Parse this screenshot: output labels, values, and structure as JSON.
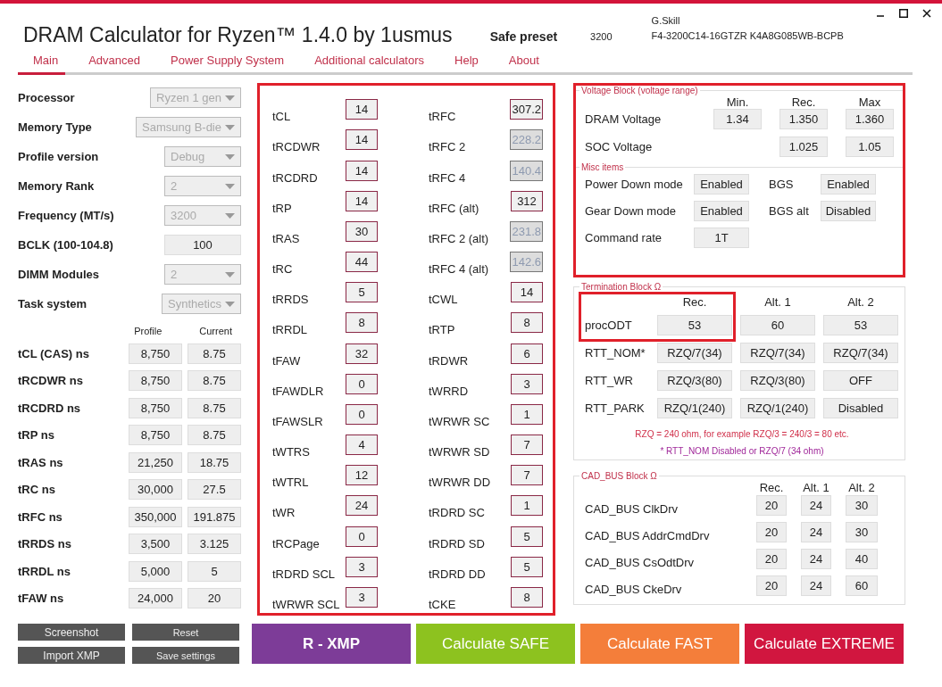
{
  "window": {
    "title": "DRAM Calculator for Ryzen™ 1.4.0 by 1usmus"
  },
  "preset": {
    "label": "Safe preset",
    "frequency": "3200"
  },
  "memory": {
    "vendor": "G.Skill",
    "part_number": "F4-3200C14-16GTZR K4A8G085WB-BCPB"
  },
  "tabs": [
    {
      "label": "Main",
      "selected": true
    },
    {
      "label": "Advanced",
      "selected": false
    },
    {
      "label": "Power Supply System",
      "selected": false
    },
    {
      "label": "Additional calculators",
      "selected": false
    },
    {
      "label": "Help",
      "selected": false
    },
    {
      "label": "About",
      "selected": false
    }
  ],
  "settings": [
    {
      "label": "Processor",
      "kind": "dropdown",
      "value": "Ryzen 1 gen",
      "disabled": true
    },
    {
      "label": "Memory Type",
      "kind": "dropdown",
      "value": "Samsung B-die",
      "disabled": true
    },
    {
      "label": "Profile version",
      "kind": "dropdown",
      "value": "Debug",
      "disabled": true
    },
    {
      "label": "Memory Rank",
      "kind": "dropdown",
      "value": "2",
      "disabled": true
    },
    {
      "label": "Frequency (MT/s)",
      "kind": "dropdown",
      "value": "3200",
      "disabled": true
    },
    {
      "label": "BCLK (100-104.8)",
      "kind": "field",
      "value": "100",
      "disabled": false
    },
    {
      "label": "DIMM Modules",
      "kind": "dropdown",
      "value": "2",
      "disabled": true
    },
    {
      "label": "Task system",
      "kind": "dropdown",
      "value": "Synthetics",
      "disabled": true
    }
  ],
  "ns_table": {
    "columns": [
      "Profile",
      "Current"
    ],
    "rows": [
      {
        "label": "tCL (CAS) ns",
        "profile": "8,750",
        "current": "8.75"
      },
      {
        "label": "tRCDWR ns",
        "profile": "8,750",
        "current": "8.75"
      },
      {
        "label": "tRCDRD ns",
        "profile": "8,750",
        "current": "8.75"
      },
      {
        "label": "tRP ns",
        "profile": "8,750",
        "current": "8.75"
      },
      {
        "label": "tRAS ns",
        "profile": "21,250",
        "current": "18.75"
      },
      {
        "label": "tRC ns",
        "profile": "30,000",
        "current": "27.5"
      },
      {
        "label": "tRFC ns",
        "profile": "350,000",
        "current": "191.875"
      },
      {
        "label": "tRRDS ns",
        "profile": "3,500",
        "current": "3.125"
      },
      {
        "label": "tRRDL ns",
        "profile": "5,000",
        "current": "5"
      },
      {
        "label": "tFAW ns",
        "profile": "24,000",
        "current": "20"
      }
    ]
  },
  "timings": {
    "highlighted": true,
    "left": [
      {
        "label": "tCL",
        "value": "14",
        "disabled": false
      },
      {
        "label": "tRCDWR",
        "value": "14",
        "disabled": false
      },
      {
        "label": "tRCDRD",
        "value": "14",
        "disabled": false
      },
      {
        "label": "tRP",
        "value": "14",
        "disabled": false
      },
      {
        "label": "tRAS",
        "value": "30",
        "disabled": false
      },
      {
        "label": "tRC",
        "value": "44",
        "disabled": false
      },
      {
        "label": "tRRDS",
        "value": "5",
        "disabled": false
      },
      {
        "label": "tRRDL",
        "value": "8",
        "disabled": false
      },
      {
        "label": "tFAW",
        "value": "32",
        "disabled": false
      },
      {
        "label": "tFAWDLR",
        "value": "0",
        "disabled": false
      },
      {
        "label": "tFAWSLR",
        "value": "0",
        "disabled": false
      },
      {
        "label": "tWTRS",
        "value": "4",
        "disabled": false
      },
      {
        "label": "tWTRL",
        "value": "12",
        "disabled": false
      },
      {
        "label": "tWR",
        "value": "24",
        "disabled": false
      },
      {
        "label": "tRCPage",
        "value": "0",
        "disabled": false
      },
      {
        "label": "tRDRD SCL",
        "value": "3",
        "disabled": false
      },
      {
        "label": "tWRWR SCL",
        "value": "3",
        "disabled": false
      }
    ],
    "right": [
      {
        "label": "tRFC",
        "value": "307.2",
        "disabled": false
      },
      {
        "label": "tRFC 2",
        "value": "228.2",
        "disabled": true
      },
      {
        "label": "tRFC 4",
        "value": "140.4",
        "disabled": true
      },
      {
        "label": "tRFC (alt)",
        "value": "312",
        "disabled": false
      },
      {
        "label": "tRFC 2 (alt)",
        "value": "231.8",
        "disabled": true
      },
      {
        "label": "tRFC 4 (alt)",
        "value": "142.6",
        "disabled": true
      },
      {
        "label": "tCWL",
        "value": "14",
        "disabled": false
      },
      {
        "label": "tRTP",
        "value": "8",
        "disabled": false
      },
      {
        "label": "tRDWR",
        "value": "6",
        "disabled": false
      },
      {
        "label": "tWRRD",
        "value": "3",
        "disabled": false
      },
      {
        "label": "tWRWR SC",
        "value": "1",
        "disabled": false
      },
      {
        "label": "tWRWR SD",
        "value": "7",
        "disabled": false
      },
      {
        "label": "tWRWR DD",
        "value": "7",
        "disabled": false
      },
      {
        "label": "tRDRD SC",
        "value": "1",
        "disabled": false
      },
      {
        "label": "tRDRD SD",
        "value": "5",
        "disabled": false
      },
      {
        "label": "tRDRD DD",
        "value": "5",
        "disabled": false
      },
      {
        "label": "tCKE",
        "value": "8",
        "disabled": false
      }
    ]
  },
  "voltage_block": {
    "title": "Voltage Block (voltage range)",
    "highlighted": true,
    "columns": [
      "Min.",
      "Rec.",
      "Max"
    ],
    "rows": [
      {
        "label": "DRAM Voltage",
        "min": "1.34",
        "rec": "1.350",
        "max": "1.360"
      },
      {
        "label": "SOC Voltage",
        "rec": "1.025",
        "max": "1.05"
      }
    ]
  },
  "misc_items": {
    "title": "Misc items",
    "items": [
      {
        "label": "Power Down mode",
        "value": "Enabled"
      },
      {
        "label": "BGS",
        "value": "Enabled"
      },
      {
        "label": "Gear Down mode",
        "value": "Enabled"
      },
      {
        "label": "BGS alt",
        "value": "Disabled"
      },
      {
        "label": "Command rate",
        "value": "1T"
      }
    ]
  },
  "termination_block": {
    "title": "Termination Block Ω",
    "columns": [
      "Rec.",
      "Alt. 1",
      "Alt. 2"
    ],
    "rows": [
      {
        "label": "procODT",
        "values": [
          "53",
          "60",
          "53"
        ],
        "highlighted": true
      },
      {
        "label": "RTT_NOM*",
        "values": [
          "RZQ/7(34)",
          "RZQ/7(34)",
          "RZQ/7(34)"
        ],
        "highlighted": false
      },
      {
        "label": "RTT_WR",
        "values": [
          "RZQ/3(80)",
          "RZQ/3(80)",
          "OFF"
        ],
        "highlighted": false
      },
      {
        "label": "RTT_PARK",
        "values": [
          "RZQ/1(240)",
          "RZQ/1(240)",
          "Disabled"
        ],
        "highlighted": false
      }
    ],
    "notes": [
      {
        "text": "RZQ = 240 ohm, for example RZQ/3 = 240/3 = 80 etc.",
        "color": "#d0304a"
      },
      {
        "text": "* RTT_NOM Disabled or RZQ/7 (34 ohm)",
        "color": "#a0289a"
      }
    ]
  },
  "cad_bus_block": {
    "title": "CAD_BUS Block Ω",
    "columns": [
      "Rec.",
      "Alt. 1",
      "Alt. 2"
    ],
    "rows": [
      {
        "label": "CAD_BUS ClkDrv",
        "values": [
          "20",
          "24",
          "30"
        ]
      },
      {
        "label": "CAD_BUS AddrCmdDrv",
        "values": [
          "20",
          "24",
          "30"
        ]
      },
      {
        "label": "CAD_BUS CsOdtDrv",
        "values": [
          "20",
          "24",
          "40"
        ]
      },
      {
        "label": "CAD_BUS CkeDrv",
        "values": [
          "20",
          "24",
          "60"
        ]
      }
    ]
  },
  "utility_buttons": [
    "Screenshot",
    "Reset",
    "Import XMP",
    "Save settings"
  ],
  "action_buttons": [
    {
      "label": "R - XMP",
      "color": "#7d3c98"
    },
    {
      "label": "Calculate SAFE",
      "color": "#8dc21f"
    },
    {
      "label": "Calculate FAST",
      "color": "#f47e3a"
    },
    {
      "label": "Calculate EXTREME",
      "color": "#d1163f"
    }
  ]
}
